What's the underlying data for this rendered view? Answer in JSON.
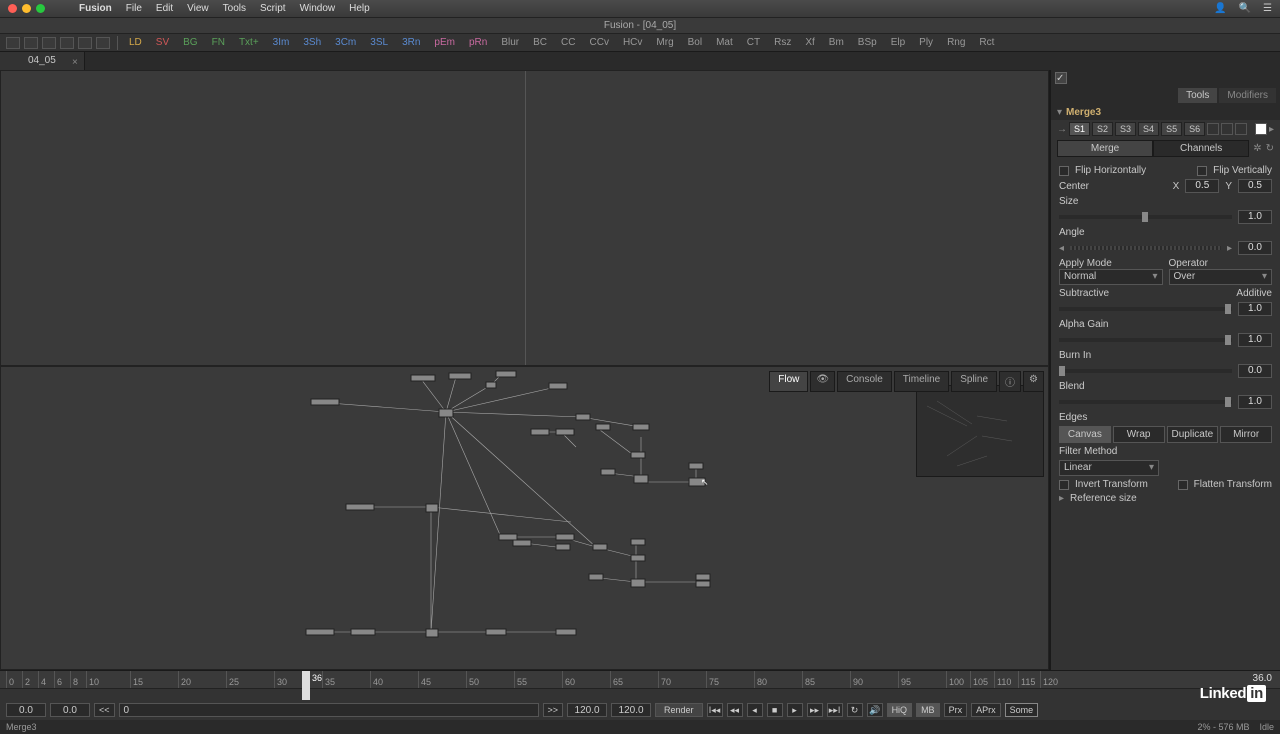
{
  "menubar": {
    "app": "Fusion",
    "items": [
      "File",
      "Edit",
      "View",
      "Tools",
      "Script",
      "Window",
      "Help"
    ]
  },
  "window_title": "Fusion - [04_05]",
  "toolbar_shorts": [
    {
      "t": "LD",
      "c": "f-ld"
    },
    {
      "t": "SV",
      "c": "f-sv"
    },
    {
      "t": "BG",
      "c": "f-bg"
    },
    {
      "t": "FN",
      "c": "f-fn"
    },
    {
      "t": "Txt+",
      "c": "f-txt"
    },
    {
      "t": "3Im",
      "c": "f-3"
    },
    {
      "t": "3Sh",
      "c": "f-3"
    },
    {
      "t": "3Cm",
      "c": "f-3"
    },
    {
      "t": "3SL",
      "c": "f-3"
    },
    {
      "t": "3Rn",
      "c": "f-3"
    },
    {
      "t": "pEm",
      "c": "f-pem"
    },
    {
      "t": "pRn",
      "c": "f-prn"
    },
    {
      "t": "Blur",
      "c": "f-blur"
    },
    {
      "t": "BC",
      "c": "f-bc"
    },
    {
      "t": "CC",
      "c": "f-cc"
    },
    {
      "t": "CCv",
      "c": "f-ccv"
    },
    {
      "t": "HCv",
      "c": "f-hcv"
    },
    {
      "t": "Mrg",
      "c": "f-mrg"
    },
    {
      "t": "Bol",
      "c": "f-bol"
    },
    {
      "t": "Mat",
      "c": "f-mat"
    },
    {
      "t": "CT",
      "c": "f-ct"
    },
    {
      "t": "Rsz",
      "c": "f-rsz"
    },
    {
      "t": "Xf",
      "c": "f-xf"
    },
    {
      "t": "Bm",
      "c": "f-bm"
    },
    {
      "t": "BSp",
      "c": "f-bsp"
    },
    {
      "t": "Elp",
      "c": "f-elp"
    },
    {
      "t": "Ply",
      "c": "f-ply"
    },
    {
      "t": "Rng",
      "c": "f-rng"
    },
    {
      "t": "Rct",
      "c": "f-rct"
    }
  ],
  "tab": {
    "name": "04_05"
  },
  "flow_tabs": {
    "flow": "Flow",
    "console": "Console",
    "timeline": "Timeline",
    "spline": "Spline"
  },
  "inspector": {
    "tabs": {
      "tools": "Tools",
      "modifiers": "Modifiers"
    },
    "node_name": "Merge3",
    "slots": [
      "S1",
      "S2",
      "S3",
      "S4",
      "S5",
      "S6"
    ],
    "subtabs": {
      "merge": "Merge",
      "channels": "Channels"
    },
    "flip_h": "Flip Horizontally",
    "flip_v": "Flip Vertically",
    "center": "Center",
    "center_x_lbl": "X",
    "center_x": "0.5",
    "center_y_lbl": "Y",
    "center_y": "0.5",
    "size": "Size",
    "size_val": "1.0",
    "angle": "Angle",
    "angle_val": "0.0",
    "apply_mode": "Apply Mode",
    "apply_mode_val": "Normal",
    "operator": "Operator",
    "operator_val": "Over",
    "subtractive": "Subtractive",
    "additive": "Additive",
    "sub_add_val": "1.0",
    "alpha_gain": "Alpha Gain",
    "alpha_gain_val": "1.0",
    "burn_in": "Burn In",
    "burn_in_val": "0.0",
    "blend": "Blend",
    "blend_val": "1.0",
    "edges": "Edges",
    "edge_canvas": "Canvas",
    "edge_wrap": "Wrap",
    "edge_dup": "Duplicate",
    "edge_mirror": "Mirror",
    "filter_method": "Filter Method",
    "filter_val": "Linear",
    "invert_xf": "Invert Transform",
    "flatten_xf": "Flatten Transform",
    "ref_size": "Reference size"
  },
  "timeline": {
    "ticks": [
      "0",
      "2",
      "4",
      "6",
      "8",
      "10",
      "15",
      "20",
      "25",
      "30",
      "35",
      "40",
      "45",
      "50",
      "55",
      "60",
      "65",
      "70",
      "75",
      "80",
      "85",
      "90",
      "95",
      "100",
      "105",
      "110",
      "115",
      "120"
    ],
    "end_label": "36.0",
    "playhead": "36",
    "start": "0.0",
    "cur": "0.0",
    "btn_back": "<<",
    "frame": "0",
    "in": "120.0",
    "out": "120.0",
    "render": "Render",
    "hiq": "HiQ",
    "mb": "MB",
    "prx": "Prx",
    "aprx": "APrx",
    "some": "Some"
  },
  "transport_go": ">>",
  "status": {
    "node": "Merge3",
    "mem": "2% - 576 MB",
    "state": "Idle"
  },
  "brand": {
    "linked": "Linked",
    "in": "in"
  }
}
